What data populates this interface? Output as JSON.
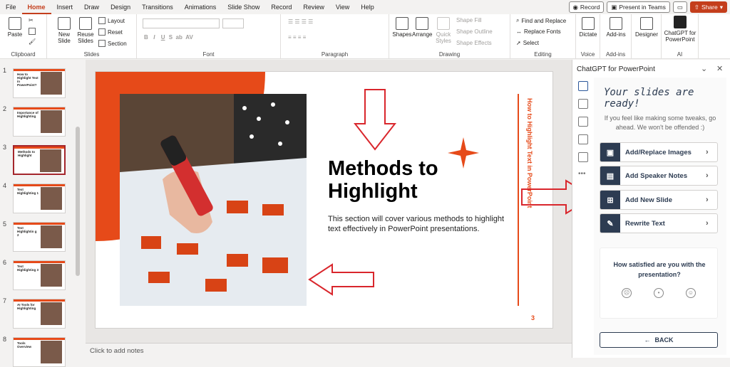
{
  "menu": {
    "tabs": [
      "File",
      "Home",
      "Insert",
      "Draw",
      "Design",
      "Transitions",
      "Animations",
      "Slide Show",
      "Record",
      "Review",
      "View",
      "Help"
    ],
    "active": "Home",
    "record_label": "Record",
    "present_label": "Present in Teams",
    "share_label": "Share"
  },
  "ribbon": {
    "clipboard": {
      "paste": "Paste",
      "label": "Clipboard"
    },
    "slides": {
      "new_slide": "New Slide",
      "reuse": "Reuse Slides",
      "layout": "Layout",
      "reset": "Reset",
      "section": "Section",
      "label": "Slides"
    },
    "font": {
      "label": "Font"
    },
    "paragraph": {
      "label": "Paragraph"
    },
    "drawing": {
      "shapes": "Shapes",
      "arrange": "Arrange",
      "quick_styles": "Quick Styles",
      "shape_fill": "Shape Fill",
      "shape_outline": "Shape Outline",
      "shape_effects": "Shape Effects",
      "label": "Drawing"
    },
    "editing": {
      "find_replace": "Find and Replace",
      "replace_fonts": "Replace Fonts",
      "select": "Select",
      "label": "Editing"
    },
    "voice": {
      "dictate": "Dictate",
      "label": "Voice"
    },
    "addins": {
      "addins": "Add-ins",
      "label": "Add-ins"
    },
    "designer": {
      "designer": "Designer"
    },
    "ai": {
      "chatgpt": "ChatGPT for PowerPoint",
      "label": "AI"
    }
  },
  "thumbnails": [
    {
      "num": "1",
      "title": "How to Highlight Text in PowerPoint?"
    },
    {
      "num": "2",
      "title": "Importance of Highlighting"
    },
    {
      "num": "3",
      "title": "Methods to Highlight"
    },
    {
      "num": "4",
      "title": "Text Highlighting 1"
    },
    {
      "num": "5",
      "title": "Text Highlightin g 2"
    },
    {
      "num": "6",
      "title": "Text Highlighting 3"
    },
    {
      "num": "7",
      "title": "AI Tools for Highlighting"
    },
    {
      "num": "8",
      "title": "Tools Overview"
    }
  ],
  "slide": {
    "title": "Methods to Highlight",
    "body": "This section will cover various methods to highlight text effectively in PowerPoint presentations.",
    "vertical_title": "How to Highlight Text in PowerPoint",
    "number": "3"
  },
  "notes_placeholder": "Click to add notes",
  "panel": {
    "header": "ChatGPT for PowerPoint",
    "ready": "Your slides are ready!",
    "subtitle": "If you feel like making some tweaks, go ahead. We won't be offended :)",
    "actions": [
      "Add/Replace Images",
      "Add Speaker Notes",
      "Add New Slide",
      "Rewrite Text"
    ],
    "question": "How satisfied are you with the presentation?",
    "back": "BACK"
  },
  "colors": {
    "accent": "#e64a19",
    "office_red": "#c43e1c",
    "panel_navy": "#2d3c52",
    "annotation_red": "#d9262c"
  }
}
